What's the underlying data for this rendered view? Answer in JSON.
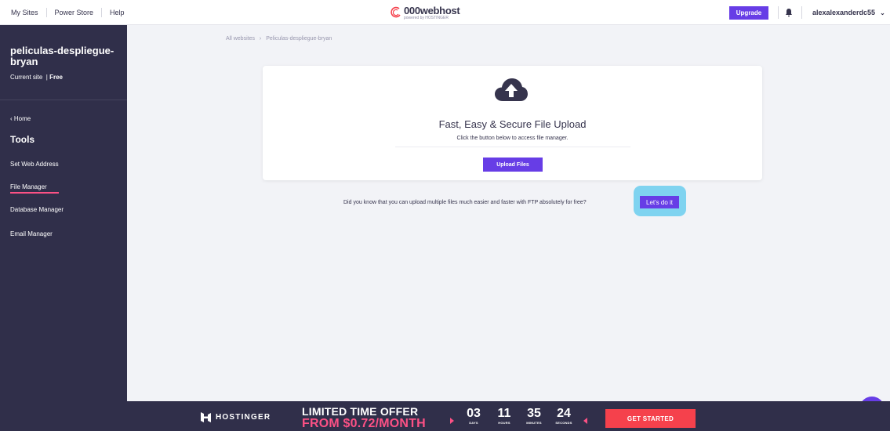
{
  "topbar": {
    "links": [
      "My Sites",
      "Power Store",
      "Help"
    ],
    "logo_main": "000webhost",
    "logo_sub": "powered by HOSTINGER",
    "upgrade_label": "Upgrade",
    "username": "alexalexanderdc55",
    "user_chevron": "⌄"
  },
  "sidebar": {
    "site_name": "peliculas-despliegue-bryan",
    "site_status": "Current site",
    "plan": "Free",
    "home_label": "Home",
    "tools_heading": "Tools",
    "items": [
      {
        "label": "Set Web Address",
        "active": false
      },
      {
        "label": "File Manager",
        "active": true
      },
      {
        "label": "Database Manager",
        "active": false
      },
      {
        "label": "Email Manager",
        "active": false
      }
    ]
  },
  "breadcrumb": {
    "root": "All websites",
    "separator": "›",
    "current": "Peliculas-despliegue-bryan"
  },
  "upload_card": {
    "icon": "cloud-upload-icon",
    "title": "Fast, Easy & Secure File Upload",
    "subtitle": "Click the button below to access file manager.",
    "button_label": "Upload Files"
  },
  "ftp_tip": {
    "text": "Did you know that you can upload multiple files much easier and faster with FTP absolutely for free?",
    "button_label": "Let's do it"
  },
  "promo": {
    "brand": "HOSTINGER",
    "headline": "LIMITED TIME OFFER",
    "price": "FROM $0.72/MONTH",
    "countdown": [
      {
        "value": "03",
        "label": "DAYS"
      },
      {
        "value": "11",
        "label": "HOURS"
      },
      {
        "value": "35",
        "label": "MINUTES"
      },
      {
        "value": "24",
        "label": "SECONDS"
      }
    ],
    "cta_label": "GET STARTED"
  },
  "colors": {
    "accent": "#673de6",
    "sidebar_bg": "#302f4a",
    "promo_red": "#f5414c",
    "highlight": "#7fd3f0"
  }
}
